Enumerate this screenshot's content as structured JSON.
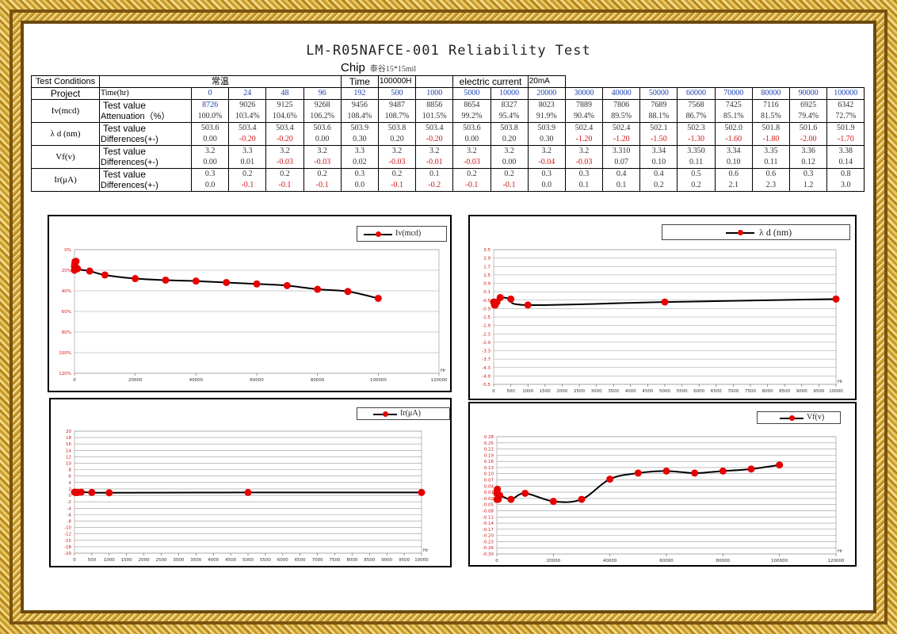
{
  "title": "LM-R05NAFCE-001 Reliability Test",
  "subtitle": "Chip",
  "subtitle_small": "泰谷15*15mil",
  "conditions": {
    "label": "Test Conditions",
    "condition_value": "常温",
    "time_label": "Time",
    "time_value": "100000H",
    "current_label": "electric current",
    "current_value": "20mA"
  },
  "table": {
    "project_label": "Project",
    "time_label": "Time(hr)",
    "times": [
      "0",
      "24",
      "48",
      "96",
      "192",
      "500",
      "1000",
      "5000",
      "10000",
      "20000",
      "30000",
      "40000",
      "50000",
      "60000",
      "70000",
      "80000",
      "90000",
      "100000"
    ],
    "rows": [
      {
        "group": "Iv(mcd)",
        "sub": "Test value",
        "values": [
          "8726",
          "9026",
          "9125",
          "9268",
          "9456",
          "9487",
          "8856",
          "8654",
          "8327",
          "8023",
          "7889",
          "7806",
          "7689",
          "7568",
          "7425",
          "7116",
          "6925",
          "6342"
        ]
      },
      {
        "group": "",
        "sub": "Attenuation（%）",
        "values": [
          "100.0%",
          "103.4%",
          "104.6%",
          "106.2%",
          "108.4%",
          "108.7%",
          "101.5%",
          "99.2%",
          "95.4%",
          "91.9%",
          "90.4%",
          "89.5%",
          "88.1%",
          "86.7%",
          "85.1%",
          "81.5%",
          "79.4%",
          "72.7%"
        ]
      },
      {
        "group": "λ d (nm)",
        "sub": "Test value",
        "values": [
          "503.6",
          "503.4",
          "503.4",
          "503.6",
          "503.9",
          "503.8",
          "503.4",
          "503.6",
          "503.8",
          "503.9",
          "502.4",
          "502.4",
          "502.1",
          "502.3",
          "502.0",
          "501.8",
          "501.6",
          "501.9"
        ]
      },
      {
        "group": "",
        "sub": "Differences(+-)",
        "values": [
          "0.00",
          "-0.20",
          "-0.20",
          "0.00",
          "0.30",
          "0.20",
          "-0.20",
          "0.00",
          "0.20",
          "0.30",
          "-1.20",
          "-1.20",
          "-1.50",
          "-1.30",
          "-1.60",
          "-1.80",
          "-2.00",
          "-1.70"
        ]
      },
      {
        "group": "Vf(v)",
        "sub": "Test value",
        "values": [
          "3.2",
          "3.3",
          "3.2",
          "3.2",
          "3.3",
          "3.2",
          "3.2",
          "3.2",
          "3.2",
          "3.2",
          "3.2",
          "3.310",
          "3.34",
          "3.350",
          "3.34",
          "3.35",
          "3.36",
          "3.38"
        ]
      },
      {
        "group": "",
        "sub": "Differences(+-)",
        "values": [
          "0.00",
          "0.01",
          "-0.03",
          "-0.03",
          "0.02",
          "-0.03",
          "-0.01",
          "-0.03",
          "0.00",
          "-0.04",
          "-0.03",
          "0.07",
          "0.10",
          "0.11",
          "0.10",
          "0.11",
          "0.12",
          "0.14"
        ]
      },
      {
        "group": "Ir(μA)",
        "sub": "Test value",
        "values": [
          "0.3",
          "0.2",
          "0.2",
          "0.2",
          "0.3",
          "0.2",
          "0.1",
          "0.2",
          "0.2",
          "0.3",
          "0.3",
          "0.4",
          "0.4",
          "0.5",
          "0.6",
          "0.6",
          "0.3",
          "0.8"
        ]
      },
      {
        "group": "",
        "sub": "Differences(+-)",
        "values": [
          "0.0",
          "-0.1",
          "-0.1",
          "-0.1",
          "0.0",
          "-0.1",
          "-0.2",
          "-0.1",
          "-0.1",
          "0.0",
          "0.1",
          "0.1",
          "0.2",
          "0.2",
          "2.1",
          "2.3",
          "1.2",
          "3.0"
        ]
      }
    ]
  },
  "colors": {
    "series_line": "#000000",
    "series_marker": "#e60000",
    "grid": "#999999",
    "value_blue": "#1a3fb0",
    "value_red": "#d01818"
  },
  "chart_data": [
    {
      "type": "line",
      "series": [
        {
          "name": "Iv(mcd)",
          "x": [
            0,
            24,
            48,
            96,
            192,
            500,
            1000,
            5000,
            10000,
            20000,
            30000,
            40000,
            50000,
            60000,
            70000,
            80000,
            90000,
            100000
          ],
          "values": [
            100.0,
            103.4,
            104.6,
            106.2,
            108.4,
            108.7,
            101.5,
            99.2,
            95.4,
            91.9,
            90.4,
            89.5,
            88.1,
            86.7,
            85.1,
            81.5,
            79.4,
            72.7
          ]
        }
      ],
      "xlim": [
        0,
        120000
      ],
      "ylim": [
        0,
        120
      ],
      "xticks": [
        "0",
        "20000",
        "40000",
        "60000",
        "80000",
        "100000",
        "120000"
      ],
      "yticks": [
        "0%",
        "20%",
        "40%",
        "60%",
        "80%",
        "100%",
        "120%"
      ],
      "xunit": "Hr"
    },
    {
      "type": "line",
      "series": [
        {
          "name": "λ d (nm)",
          "x": [
            0,
            24,
            48,
            96,
            192,
            500,
            1000,
            5000,
            10000
          ],
          "values": [
            0.0,
            -0.2,
            -0.2,
            0.0,
            0.3,
            0.2,
            -0.2,
            0.0,
            0.2
          ]
        }
      ],
      "xlim": [
        0,
        10000
      ],
      "ylim": [
        -5.5,
        3.5
      ],
      "xticks": [
        "0",
        "500",
        "1000",
        "1500",
        "2000",
        "2500",
        "3000",
        "3500",
        "4000",
        "4500",
        "5000",
        "5500",
        "6000",
        "6500",
        "7000",
        "7500",
        "8000",
        "8500",
        "9000",
        "9500",
        "10000"
      ],
      "yticks": [
        "3.5",
        "2.9",
        "1.7",
        "1.5",
        "0.9",
        "0.1",
        "-0.5",
        "-0.9",
        "-1.5",
        "-1.9",
        "-2.3",
        "-2.9",
        "-3.3",
        "-3.7",
        "-4.3",
        "-4.9",
        "-5.5"
      ],
      "xunit": "Hr"
    },
    {
      "type": "line",
      "series": [
        {
          "name": "Ir(μA)",
          "x": [
            0,
            24,
            48,
            96,
            192,
            500,
            1000,
            5000,
            10000
          ],
          "values": [
            0.0,
            -0.1,
            -0.1,
            -0.1,
            0.0,
            -0.1,
            -0.2,
            -0.1,
            -0.1
          ]
        }
      ],
      "xlim": [
        0,
        10000
      ],
      "ylim": [
        -20,
        20
      ],
      "xticks": [
        "0",
        "500",
        "1000",
        "1500",
        "2000",
        "2500",
        "3000",
        "3500",
        "4000",
        "4500",
        "5000",
        "5500",
        "6000",
        "6500",
        "7000",
        "7500",
        "8000",
        "8500",
        "9000",
        "9500",
        "10000"
      ],
      "yticks": [
        "20",
        "18",
        "16",
        "14",
        "12",
        "10",
        "8",
        "6",
        "4",
        "2",
        "0",
        "-2",
        "-4",
        "-6",
        "-8",
        "-10",
        "-12",
        "-15",
        "-18",
        "-20"
      ],
      "xunit": "Hr"
    },
    {
      "type": "line",
      "series": [
        {
          "name": "Vf(v)",
          "x": [
            0,
            24,
            48,
            96,
            192,
            500,
            1000,
            5000,
            10000,
            20000,
            30000,
            40000,
            50000,
            60000,
            70000,
            80000,
            90000,
            100000
          ],
          "values": [
            0.0,
            0.01,
            -0.03,
            -0.03,
            0.02,
            -0.03,
            -0.01,
            -0.03,
            0.0,
            -0.04,
            -0.03,
            0.07,
            0.1,
            0.11,
            0.1,
            0.11,
            0.12,
            0.14
          ]
        }
      ],
      "xlim": [
        0,
        120000
      ],
      "ylim": [
        -0.3,
        0.28
      ],
      "xticks": [
        "0",
        "20000",
        "40000",
        "60000",
        "80000",
        "100000",
        "120000"
      ],
      "yticks": [
        "0.28",
        "0.25",
        "0.22",
        "0.19",
        "0.16",
        "0.13",
        "0.10",
        "0.07",
        "0.04",
        "0.01",
        "-0.02",
        "-0.05",
        "-0.08",
        "-0.11",
        "-0.14",
        "-0.17",
        "-0.20",
        "-0.23",
        "-0.26",
        "-0.30"
      ],
      "xunit": "Hr"
    }
  ]
}
